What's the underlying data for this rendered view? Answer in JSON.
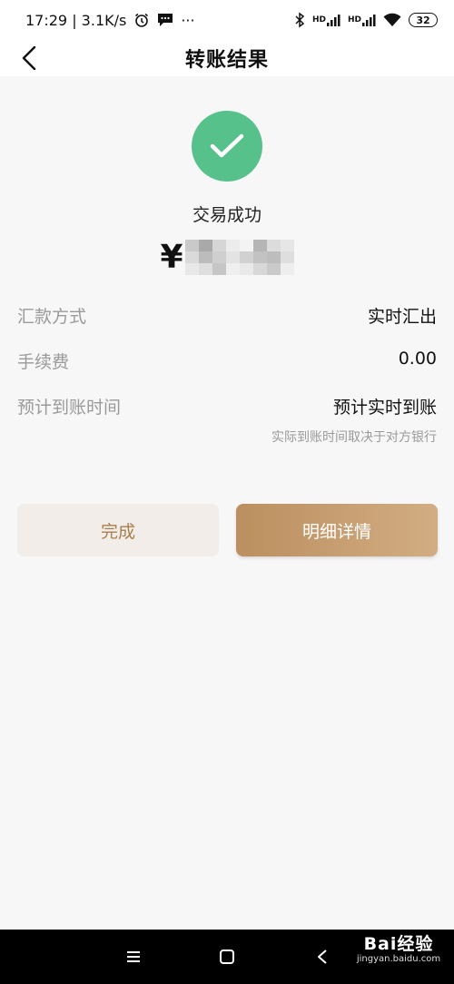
{
  "status_bar": {
    "time_speed": "17:29 | 3.1K/s",
    "more": "···",
    "network_1": "HD",
    "network_2": "HD",
    "battery": "32"
  },
  "nav": {
    "title": "转账结果"
  },
  "result": {
    "status": "交易成功",
    "currency_symbol": "¥",
    "amount_obscured": true
  },
  "details": [
    {
      "label": "汇款方式",
      "value": "实时汇出"
    },
    {
      "label": "手续费",
      "value": "0.00"
    },
    {
      "label": "预计到账时间",
      "value": "预计实时到账",
      "note": "实际到账时间取决于对方银行"
    }
  ],
  "buttons": {
    "done": "完成",
    "detail": "明细详情"
  },
  "watermark": {
    "main": "Bai经验",
    "sub": "jingyan.baidu.com"
  },
  "colors": {
    "success": "#56c18a",
    "accent": "#bb8f60",
    "done_bg": "#f2ede8",
    "done_text": "#a8804f"
  }
}
